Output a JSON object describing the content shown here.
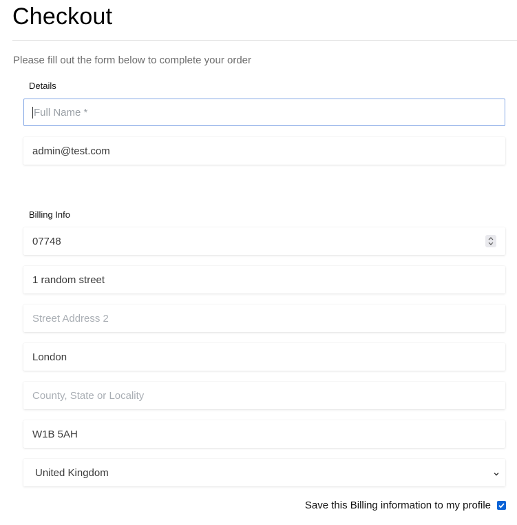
{
  "page": {
    "title": "Checkout",
    "subtitle": "Please fill out the form below to complete your order"
  },
  "details": {
    "label": "Details",
    "full_name": {
      "value": "",
      "placeholder": "Full Name *"
    },
    "email": {
      "value": "admin@test.com",
      "placeholder": ""
    }
  },
  "billing": {
    "label": "Billing Info",
    "number": {
      "value": "07748"
    },
    "street1": {
      "value": "1 random street",
      "placeholder": ""
    },
    "street2": {
      "value": "",
      "placeholder": "Street Address 2"
    },
    "city": {
      "value": "London",
      "placeholder": ""
    },
    "county": {
      "value": "",
      "placeholder": "County, State or Locality"
    },
    "postcode": {
      "value": "W1B 5AH",
      "placeholder": ""
    },
    "country": {
      "selected": "United Kingdom"
    },
    "save_label": "Save this Billing information to my profile",
    "save_checked": true
  },
  "icons": {
    "spinner": "spinner-arrows-icon",
    "select": "chevron-down-icon",
    "check": "checkmark-icon"
  },
  "colors": {
    "focus_border": "#86a9e6",
    "checkbox": "#0b63d6",
    "placeholder": "#a9aeb4"
  }
}
